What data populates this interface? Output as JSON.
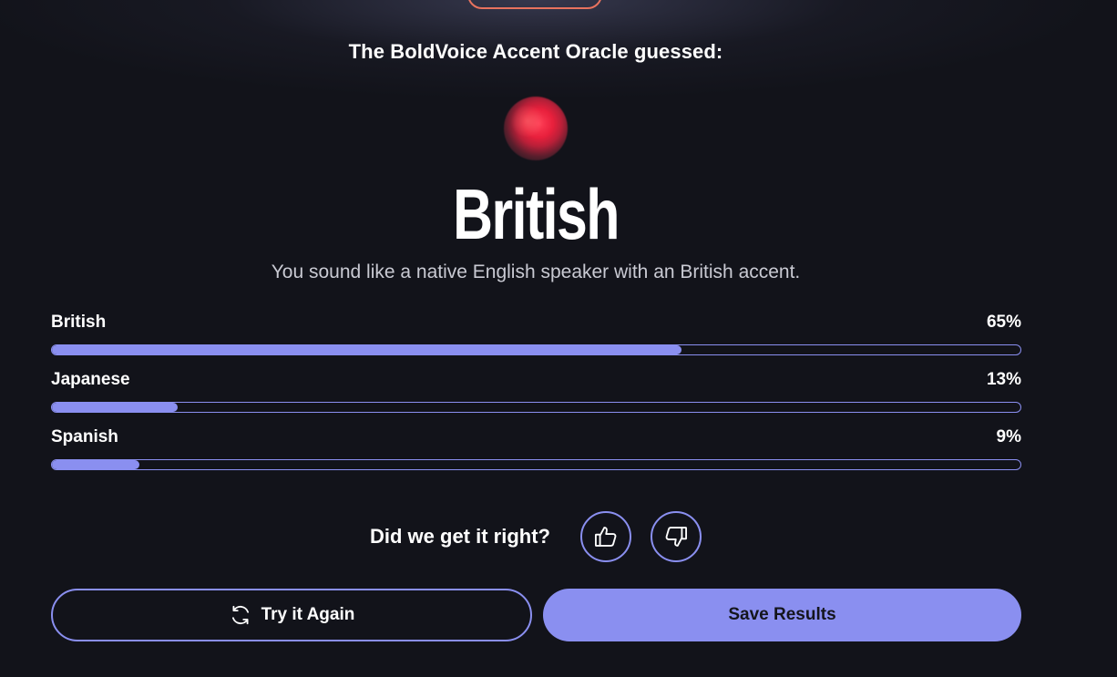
{
  "header": {
    "oracle_heading": "The BoldVoice Accent Oracle guessed:"
  },
  "result": {
    "accent": "British",
    "description": "You sound like a native English speaker with an British accent."
  },
  "breakdown": [
    {
      "label": "British",
      "percent_label": "65%",
      "percent": 65
    },
    {
      "label": "Japanese",
      "percent_label": "13%",
      "percent": 13
    },
    {
      "label": "Spanish",
      "percent_label": "9%",
      "percent": 9
    }
  ],
  "feedback": {
    "question": "Did we get it right?",
    "thumbs_up_icon": "thumbs-up-icon",
    "thumbs_down_icon": "thumbs-down-icon"
  },
  "actions": {
    "try_again_label": "Try it Again",
    "try_again_icon": "refresh-icon",
    "save_label": "Save Results"
  },
  "colors": {
    "background": "#12131a",
    "accent": "#8a8ff0",
    "top_button_border": "#e8725e",
    "orb": "#e8203c"
  }
}
